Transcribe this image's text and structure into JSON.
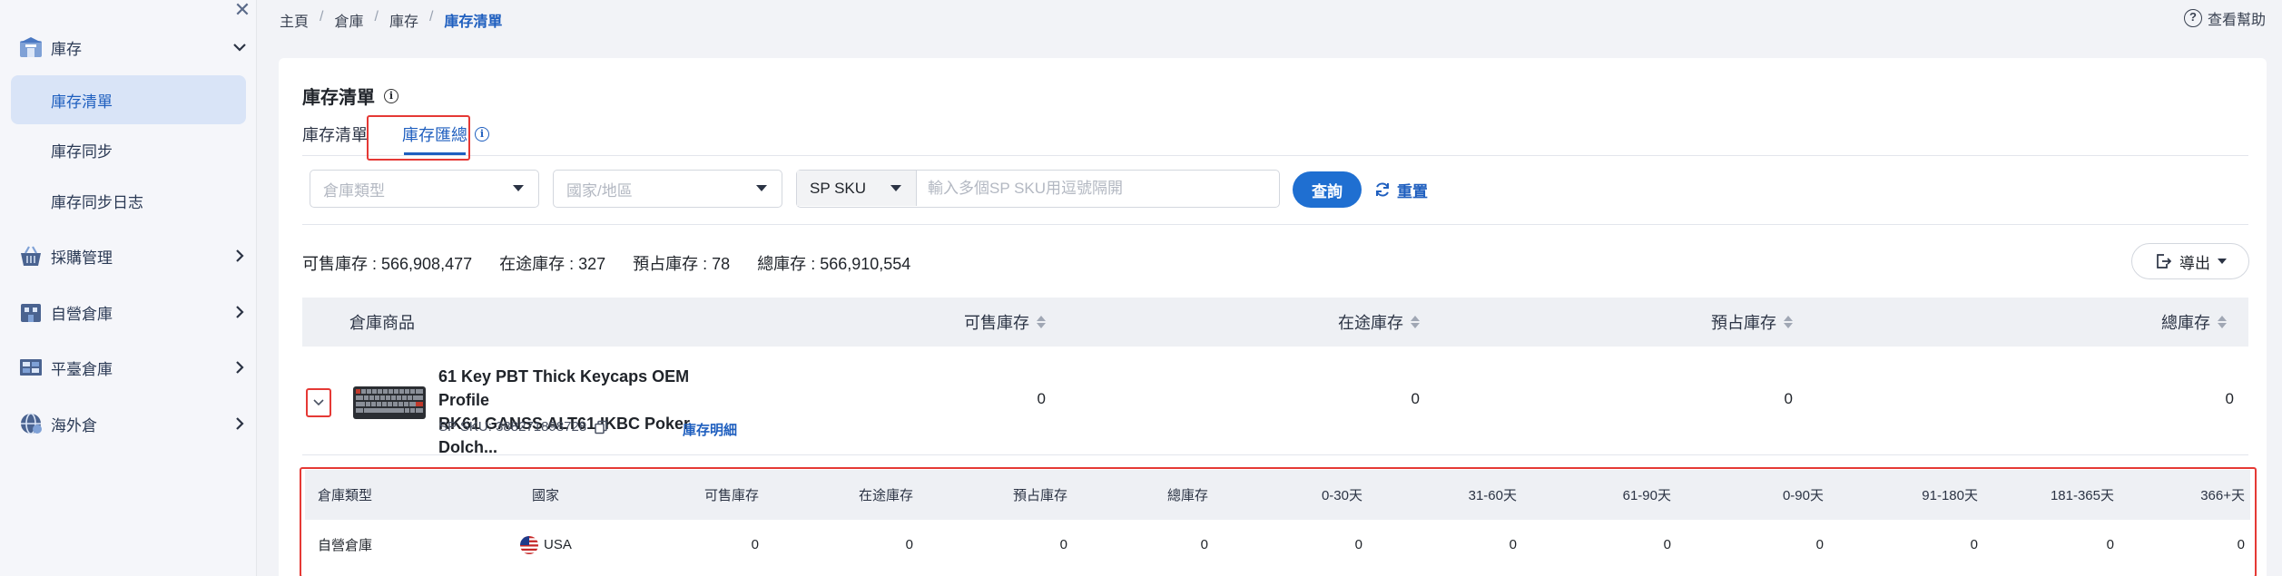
{
  "sidebar": {
    "groups": [
      {
        "label": "庫存",
        "icon": "warehouse-box-icon",
        "expanded": true
      },
      {
        "label": "採購管理",
        "icon": "basket-icon"
      },
      {
        "label": "自營倉庫",
        "icon": "building-icon"
      },
      {
        "label": "平臺倉庫",
        "icon": "shelf-icon"
      },
      {
        "label": "海外倉",
        "icon": "globe-icon"
      }
    ],
    "sub_items": [
      {
        "label": "庫存清單",
        "active": true
      },
      {
        "label": "庫存同步"
      },
      {
        "label": "庫存同步日志"
      }
    ]
  },
  "breadcrumb": [
    "主頁",
    "倉庫",
    "庫存",
    "庫存清單"
  ],
  "help_label": "查看幫助",
  "page_title": "庫存清單",
  "tabs": [
    {
      "label": "庫存清單",
      "active": false
    },
    {
      "label": "庫存匯總",
      "active": true
    }
  ],
  "filters": {
    "warehouse_type_placeholder": "倉庫類型",
    "country_placeholder": "國家/地區",
    "sku_type": "SP SKU",
    "sku_placeholder": "輸入多個SP SKU用逗號隔開",
    "query_label": "查詢",
    "reset_label": "重置"
  },
  "stats": {
    "available": "可售庫存 : 566,908,477",
    "in_transit": "在途庫存 : 327",
    "reserved": "預占庫存 : 78",
    "total": "總庫存 : 566,910,554"
  },
  "export_label": "導出",
  "table": {
    "headers": {
      "product": "倉庫商品",
      "available": "可售庫存",
      "in_transit": "在途庫存",
      "reserved": "預占庫存",
      "total": "總庫存"
    },
    "rows": [
      {
        "name_line1": "61 Key PBT Thick Keycaps OEM Profile",
        "name_line2": "RK61 GANSS ALT61 IKBC Poker Dolch...",
        "sku": "SP SKU: 388271898728",
        "detail_link": "庫存明細",
        "available": "0",
        "in_transit": "0",
        "reserved": "0",
        "total": "0"
      }
    ]
  },
  "sub_table": {
    "headers": [
      "倉庫類型",
      "國家",
      "可售庫存",
      "在途庫存",
      "預占庫存",
      "總庫存",
      "0-30天",
      "31-60天",
      "61-90天",
      "0-90天",
      "91-180天",
      "181-365天",
      "366+天"
    ],
    "rows": [
      [
        "自營倉庫",
        "USA",
        "0",
        "0",
        "0",
        "0",
        "0",
        "0",
        "0",
        "0",
        "0",
        "0",
        "0"
      ]
    ]
  },
  "colors": {
    "accent": "#1f5fbf",
    "button": "#1f6fd1",
    "highlight": "#e53935",
    "active_bg": "#d9e4f7"
  }
}
